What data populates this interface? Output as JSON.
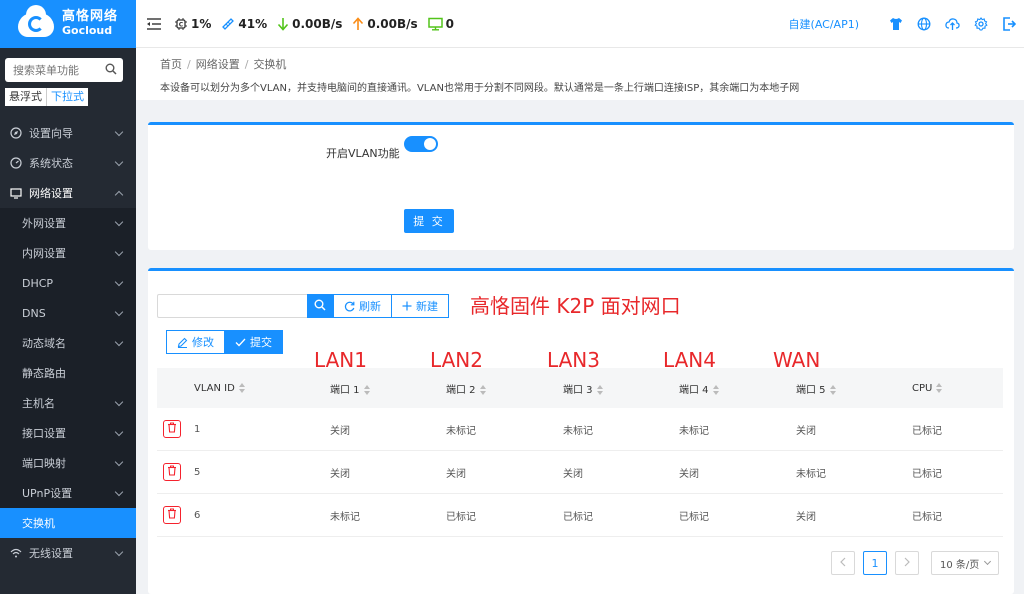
{
  "logo": {
    "cn": "高恪网络",
    "en": "Gocloud"
  },
  "sidebar": {
    "search_placeholder": "搜索菜单功能",
    "mode_float": "悬浮式",
    "mode_dropdown": "下拉式",
    "items": [
      {
        "label": "设置向导"
      },
      {
        "label": "系统状态"
      },
      {
        "label": "网络设置"
      }
    ],
    "subitems": [
      {
        "label": "外网设置"
      },
      {
        "label": "内网设置"
      },
      {
        "label": "DHCP"
      },
      {
        "label": "DNS"
      },
      {
        "label": "动态域名"
      },
      {
        "label": "静态路由"
      },
      {
        "label": "主机名"
      },
      {
        "label": "接口设置"
      },
      {
        "label": "端口映射"
      },
      {
        "label": "UPnP设置"
      },
      {
        "label": "交换机"
      }
    ],
    "after": [
      {
        "label": "无线设置"
      }
    ]
  },
  "topbar": {
    "cpu": "1%",
    "mem": "41%",
    "down": "0.00B/s",
    "up": "0.00B/s",
    "clients": "0",
    "mode": "自建(AC/AP1)"
  },
  "colors": {
    "accent": "#1890ff",
    "sidebar": "#242a33",
    "danger": "#f5222d",
    "annotation": "#e8282b"
  },
  "breadcrumb": [
    "首页",
    "网络设置",
    "交换机"
  ],
  "description": "本设备可以划分为多个VLAN，并支持电脑间的直接通讯。VLAN也常用于分割不同网段。默认通常是一条上行端口连接ISP，其余端口为本地子网",
  "vlan_card": {
    "toggle_label": "开启VLAN功能",
    "toggle_on": true,
    "submit": "提 交"
  },
  "table_toolbar": {
    "refresh": "刷新",
    "add": "新建",
    "edit": "修改",
    "submit": "提交"
  },
  "annotations": {
    "title": "高恪固件  K2P  面对网口",
    "ports": [
      "LAN1",
      "LAN2",
      "LAN3",
      "LAN4",
      "WAN"
    ]
  },
  "table": {
    "headers": [
      "VLAN ID",
      "端口 1",
      "端口 2",
      "端口 3",
      "端口 4",
      "端口 5",
      "CPU"
    ],
    "rows": [
      [
        "1",
        "关闭",
        "未标记",
        "未标记",
        "未标记",
        "关闭",
        "已标记"
      ],
      [
        "5",
        "关闭",
        "关闭",
        "关闭",
        "关闭",
        "未标记",
        "已标记"
      ],
      [
        "6",
        "未标记",
        "已标记",
        "已标记",
        "已标记",
        "关闭",
        "已标记"
      ]
    ]
  },
  "pager": {
    "current": "1",
    "page_size": "10 条/页"
  }
}
